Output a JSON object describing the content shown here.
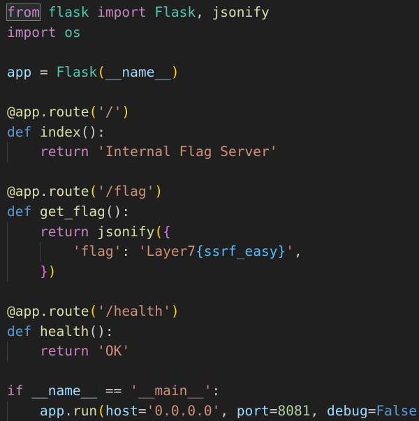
{
  "editor": {
    "language": "python",
    "colors": {
      "background": "#1f1f1f",
      "keyword_control": "#c586c0",
      "keyword_storage": "#569cd6",
      "module": "#4ec9b0",
      "function": "#dcdcaa",
      "string": "#ce9178",
      "number": "#b5cea8",
      "variable": "#9cdcfe",
      "plain": "#cccccc",
      "bracket_1": "#ffd700",
      "bracket_2": "#da70d6",
      "bracket_3": "#179fff",
      "placeholder": "#4fc1ff"
    },
    "lines": [
      {
        "indent": 0,
        "tokens": [
          {
            "text": "from",
            "color": "#c586c0",
            "boxed": true
          },
          {
            "text": " ",
            "color": "#cccccc"
          },
          {
            "text": "flask",
            "color": "#4ec9b0"
          },
          {
            "text": " ",
            "color": "#cccccc"
          },
          {
            "text": "import",
            "color": "#c586c0"
          },
          {
            "text": " ",
            "color": "#cccccc"
          },
          {
            "text": "Flask",
            "color": "#4ec9b0"
          },
          {
            "text": ", ",
            "color": "#cccccc"
          },
          {
            "text": "jsonify",
            "color": "#dcdcaa"
          }
        ]
      },
      {
        "indent": 0,
        "tokens": [
          {
            "text": "import",
            "color": "#c586c0"
          },
          {
            "text": " ",
            "color": "#cccccc"
          },
          {
            "text": "os",
            "color": "#4ec9b0"
          }
        ]
      },
      {
        "indent": 0,
        "tokens": []
      },
      {
        "indent": 0,
        "tokens": [
          {
            "text": "app",
            "color": "#9cdcfe"
          },
          {
            "text": " = ",
            "color": "#cccccc"
          },
          {
            "text": "Flask",
            "color": "#4ec9b0"
          },
          {
            "text": "(",
            "color": "#ffd700"
          },
          {
            "text": "__name__",
            "color": "#9cdcfe"
          },
          {
            "text": ")",
            "color": "#ffd700"
          }
        ]
      },
      {
        "indent": 0,
        "tokens": []
      },
      {
        "indent": 0,
        "tokens": [
          {
            "text": "@",
            "color": "#dcdcaa"
          },
          {
            "text": "app",
            "color": "#dcdcaa"
          },
          {
            "text": ".",
            "color": "#cccccc"
          },
          {
            "text": "route",
            "color": "#dcdcaa"
          },
          {
            "text": "(",
            "color": "#ffd700"
          },
          {
            "text": "'/'",
            "color": "#ce9178"
          },
          {
            "text": ")",
            "color": "#ffd700"
          }
        ]
      },
      {
        "indent": 0,
        "tokens": [
          {
            "text": "def",
            "color": "#569cd6"
          },
          {
            "text": " ",
            "color": "#cccccc"
          },
          {
            "text": "index",
            "color": "#dcdcaa"
          },
          {
            "text": "():",
            "color": "#cccccc"
          }
        ]
      },
      {
        "indent": 1,
        "tokens": [
          {
            "text": "    ",
            "color": "#cccccc"
          },
          {
            "text": "return",
            "color": "#c586c0"
          },
          {
            "text": " ",
            "color": "#cccccc"
          },
          {
            "text": "'Internal Flag Server'",
            "color": "#ce9178"
          }
        ]
      },
      {
        "indent": 0,
        "tokens": []
      },
      {
        "indent": 0,
        "tokens": [
          {
            "text": "@",
            "color": "#dcdcaa"
          },
          {
            "text": "app",
            "color": "#dcdcaa"
          },
          {
            "text": ".",
            "color": "#cccccc"
          },
          {
            "text": "route",
            "color": "#dcdcaa"
          },
          {
            "text": "(",
            "color": "#ffd700"
          },
          {
            "text": "'/flag'",
            "color": "#ce9178"
          },
          {
            "text": ")",
            "color": "#ffd700"
          }
        ]
      },
      {
        "indent": 0,
        "tokens": [
          {
            "text": "def",
            "color": "#569cd6"
          },
          {
            "text": " ",
            "color": "#cccccc"
          },
          {
            "text": "get_flag",
            "color": "#dcdcaa"
          },
          {
            "text": "():",
            "color": "#cccccc"
          }
        ]
      },
      {
        "indent": 1,
        "tokens": [
          {
            "text": "    ",
            "color": "#cccccc"
          },
          {
            "text": "return",
            "color": "#c586c0"
          },
          {
            "text": " ",
            "color": "#cccccc"
          },
          {
            "text": "jsonify",
            "color": "#dcdcaa"
          },
          {
            "text": "(",
            "color": "#ffd700"
          },
          {
            "text": "{",
            "color": "#da70d6"
          }
        ]
      },
      {
        "indent": 2,
        "tokens": [
          {
            "text": "        ",
            "color": "#cccccc"
          },
          {
            "text": "'flag'",
            "color": "#ce9178"
          },
          {
            "text": ": ",
            "color": "#cccccc"
          },
          {
            "text": "'Layer7",
            "color": "#ce9178"
          },
          {
            "text": "{ssrf_easy}",
            "color": "#4fc1ff"
          },
          {
            "text": "'",
            "color": "#ce9178"
          },
          {
            "text": ",",
            "color": "#cccccc"
          }
        ]
      },
      {
        "indent": 1,
        "tokens": [
          {
            "text": "    ",
            "color": "#cccccc"
          },
          {
            "text": "}",
            "color": "#da70d6"
          },
          {
            "text": ")",
            "color": "#ffd700"
          }
        ]
      },
      {
        "indent": 0,
        "tokens": []
      },
      {
        "indent": 0,
        "tokens": [
          {
            "text": "@",
            "color": "#dcdcaa"
          },
          {
            "text": "app",
            "color": "#dcdcaa"
          },
          {
            "text": ".",
            "color": "#cccccc"
          },
          {
            "text": "route",
            "color": "#dcdcaa"
          },
          {
            "text": "(",
            "color": "#ffd700"
          },
          {
            "text": "'/health'",
            "color": "#ce9178"
          },
          {
            "text": ")",
            "color": "#ffd700"
          }
        ]
      },
      {
        "indent": 0,
        "tokens": [
          {
            "text": "def",
            "color": "#569cd6"
          },
          {
            "text": " ",
            "color": "#cccccc"
          },
          {
            "text": "health",
            "color": "#dcdcaa"
          },
          {
            "text": "():",
            "color": "#cccccc"
          }
        ]
      },
      {
        "indent": 1,
        "tokens": [
          {
            "text": "    ",
            "color": "#cccccc"
          },
          {
            "text": "return",
            "color": "#c586c0"
          },
          {
            "text": " ",
            "color": "#cccccc"
          },
          {
            "text": "'OK'",
            "color": "#ce9178"
          }
        ]
      },
      {
        "indent": 0,
        "tokens": []
      },
      {
        "indent": 0,
        "tokens": [
          {
            "text": "if",
            "color": "#c586c0"
          },
          {
            "text": " ",
            "color": "#cccccc"
          },
          {
            "text": "__name__",
            "color": "#9cdcfe"
          },
          {
            "text": " == ",
            "color": "#cccccc"
          },
          {
            "text": "'__main__'",
            "color": "#ce9178"
          },
          {
            "text": ":",
            "color": "#cccccc"
          }
        ]
      },
      {
        "indent": 1,
        "tokens": [
          {
            "text": "    ",
            "color": "#cccccc"
          },
          {
            "text": "app",
            "color": "#9cdcfe"
          },
          {
            "text": ".",
            "color": "#cccccc"
          },
          {
            "text": "run",
            "color": "#dcdcaa"
          },
          {
            "text": "(",
            "color": "#ffd700"
          },
          {
            "text": "host",
            "color": "#9cdcfe"
          },
          {
            "text": "=",
            "color": "#cccccc"
          },
          {
            "text": "'0.0.0.0'",
            "color": "#ce9178"
          },
          {
            "text": ", ",
            "color": "#cccccc"
          },
          {
            "text": "port",
            "color": "#9cdcfe"
          },
          {
            "text": "=",
            "color": "#cccccc"
          },
          {
            "text": "8081",
            "color": "#b5cea8"
          },
          {
            "text": ", ",
            "color": "#cccccc"
          },
          {
            "text": "debug",
            "color": "#9cdcfe"
          },
          {
            "text": "=",
            "color": "#cccccc"
          },
          {
            "text": "False",
            "color": "#569cd6"
          },
          {
            "text": ")",
            "color": "#ffd700"
          }
        ]
      }
    ]
  }
}
